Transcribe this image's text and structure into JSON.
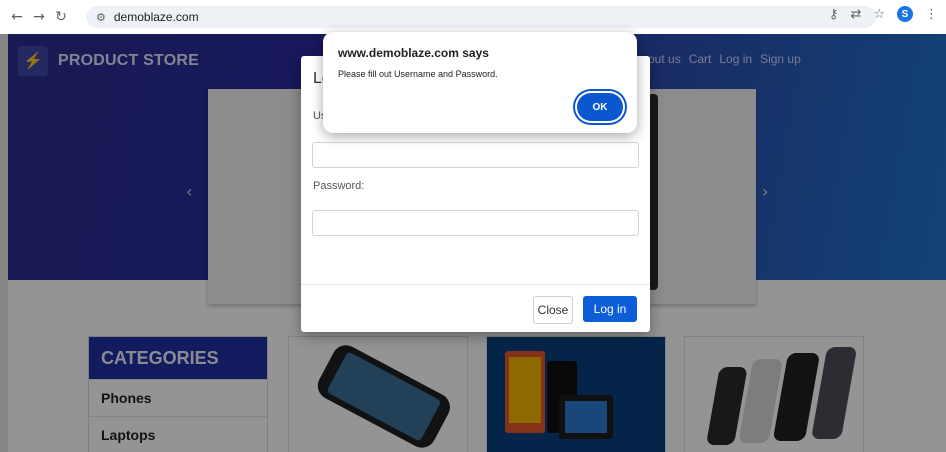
{
  "browser": {
    "url": "demoblaze.com",
    "profile_initial": "S",
    "icons": [
      "back-arrow-icon",
      "forward-arrow-icon",
      "reload-icon",
      "site-info-icon",
      "key-icon",
      "translate-icon",
      "star-icon",
      "menu-dots-icon"
    ]
  },
  "page": {
    "brand": "PRODUCT STORE",
    "nav": [
      "out us",
      "Cart",
      "Log in",
      "Sign up"
    ],
    "categories": {
      "title": "CATEGORIES",
      "items": [
        "Phones",
        "Laptops"
      ]
    }
  },
  "login_modal": {
    "title": "Lo",
    "username_label": "Us",
    "password_label": "Password:",
    "close_label": "Close",
    "login_label": "Log in"
  },
  "alert": {
    "title": "www.demoblaze.com says",
    "message": "Please fill out Username and Password.",
    "ok_label": "OK"
  },
  "colors": {
    "accent": "#0b57d0",
    "modal_primary": "#0b5ed7",
    "hero_left": "#2b2d8f",
    "hero_right": "#1f73c9"
  }
}
